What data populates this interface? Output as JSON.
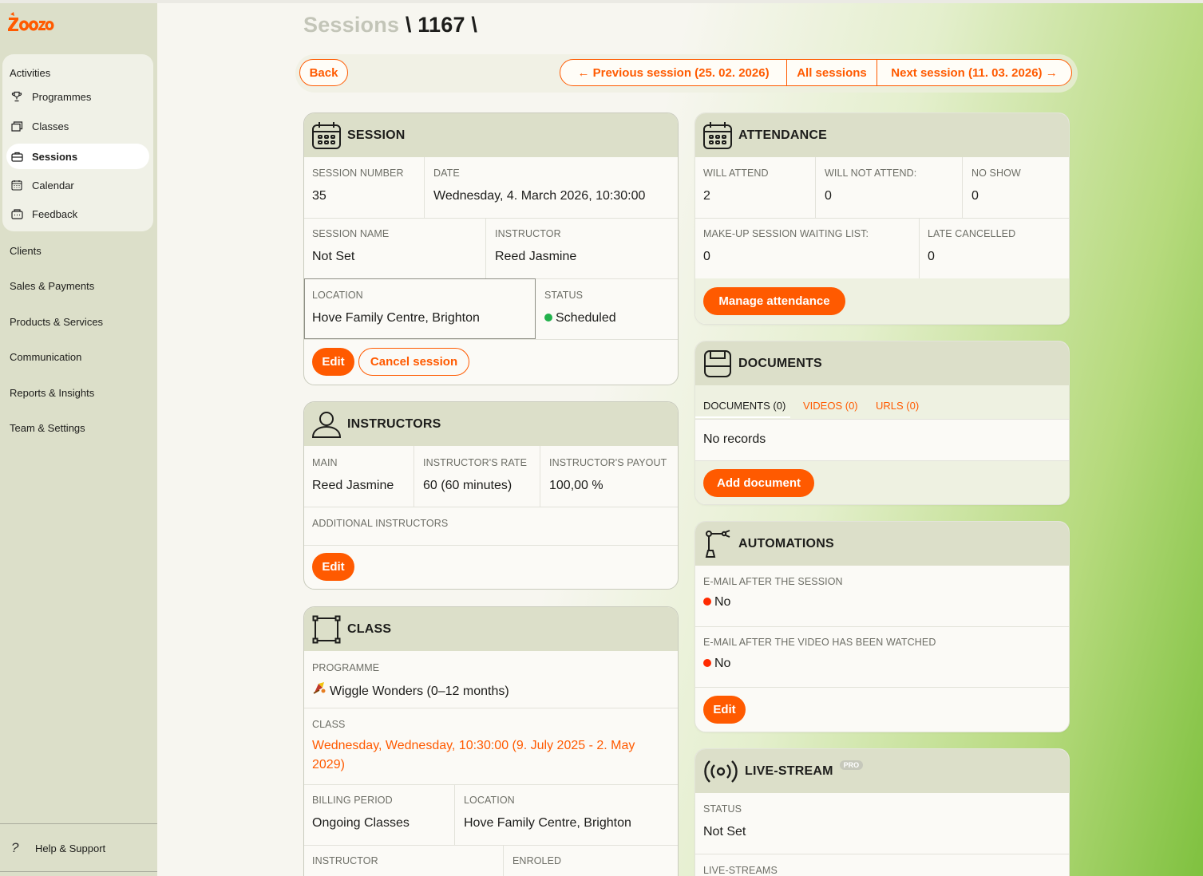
{
  "app": {
    "logo_text": "zooza"
  },
  "sidebar": {
    "group_title": "Activities",
    "items": [
      {
        "label": "Programmes",
        "icon": "trophy-icon"
      },
      {
        "label": "Classes",
        "icon": "folder-icon"
      },
      {
        "label": "Sessions",
        "icon": "briefcase-icon",
        "active": true
      },
      {
        "label": "Calendar",
        "icon": "calendar-icon"
      },
      {
        "label": "Feedback",
        "icon": "feedback-icon"
      }
    ],
    "top_items": [
      "Clients",
      "Sales & Payments",
      "Products & Services",
      "Communication",
      "Reports & Insights",
      "Team & Settings"
    ],
    "help": "Help & Support"
  },
  "header": {
    "breadcrumb_muted": "Sessions",
    "sep1": "\\",
    "id": "1167",
    "sep2": "\\"
  },
  "toolbar": {
    "back": "Back",
    "previous": "← Previous session (25. 02. 2026)",
    "all": "All sessions",
    "next": "Next session (11. 03. 2026) →"
  },
  "session": {
    "title": "SESSION",
    "number_label": "SESSION NUMBER",
    "number": "35",
    "date_label": "DATE",
    "date": "Wednesday, 4. March 2026, 10:30:00",
    "name_label": "SESSION NAME",
    "name": "Not Set",
    "instructor_label": "INSTRUCTOR",
    "instructor": "Reed Jasmine",
    "location_label": "LOCATION",
    "location": "Hove Family Centre, Brighton",
    "status_label": "STATUS",
    "status": "Scheduled",
    "edit": "Edit",
    "cancel": "Cancel session"
  },
  "instructors": {
    "title": "INSTRUCTORS",
    "main_label": "MAIN",
    "main": "Reed Jasmine",
    "rate_label": "INSTRUCTOR'S RATE",
    "rate": "60 (60 minutes)",
    "payout_label": "INSTRUCTOR'S PAYOUT",
    "payout": "100,00 %",
    "additional_label": "ADDITIONAL INSTRUCTORS",
    "edit": "Edit"
  },
  "class": {
    "title": "CLASS",
    "programme_label": "PROGRAMME",
    "programme": "Wiggle Wonders (0–12 months)",
    "class_label": "CLASS",
    "class_value": "Wednesday, Wednesday, 10:30:00 (9. July 2025 - 2. May 2029)",
    "billing_label": "BILLING PERIOD",
    "billing": "Ongoing Classes",
    "location_label": "LOCATION",
    "location": "Hove Family Centre, Brighton",
    "instructor_label": "INSTRUCTOR",
    "enroled_label": "ENROLED"
  },
  "attendance": {
    "title": "ATTENDANCE",
    "will_attend_label": "WILL ATTEND",
    "will_attend": "2",
    "will_not_label": "WILL NOT ATTEND:",
    "will_not": "0",
    "no_show_label": "NO SHOW",
    "no_show": "0",
    "makeup_label": "MAKE-UP SESSION WAITING LIST:",
    "makeup": "0",
    "late_label": "LATE CANCELLED",
    "late": "0",
    "manage": "Manage attendance"
  },
  "documents": {
    "title": "DOCUMENTS",
    "tabs": [
      "DOCUMENTS (0)",
      "VIDEOS (0)",
      "URLS (0)"
    ],
    "empty": "No records",
    "add": "Add document"
  },
  "automations": {
    "title": "AUTOMATIONS",
    "email_session_label": "E-MAIL AFTER THE SESSION",
    "email_session": "No",
    "email_video_label": "E-MAIL AFTER THE VIDEO HAS BEEN WATCHED",
    "email_video": "No",
    "edit": "Edit"
  },
  "livestream": {
    "title": "LIVE-STREAM",
    "badge": "PRO",
    "status_label": "STATUS",
    "status": "Not Set",
    "streams_label": "LIVE-STREAMS"
  },
  "colors": {
    "accent": "#ff5a00",
    "header_band": "#dcdfc9",
    "status_ok": "#22b14c",
    "status_no": "#ff2a00"
  }
}
